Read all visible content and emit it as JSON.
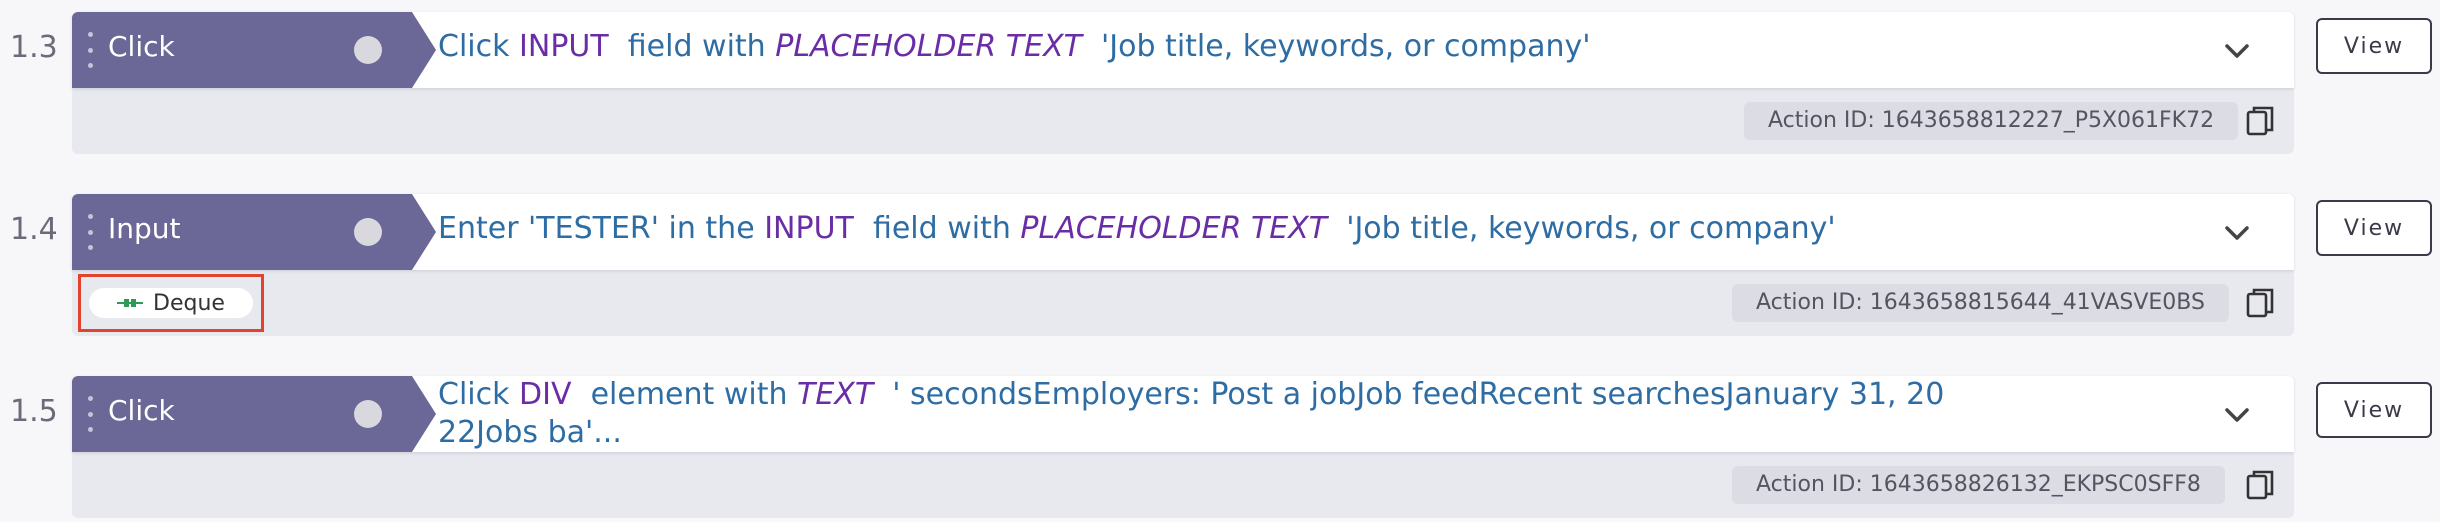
{
  "view_label": "View",
  "steps": [
    {
      "number": "1.3",
      "action_type": "Click",
      "desc": {
        "verb": "Click ",
        "element": "INPUT",
        "mid": "  field with ",
        "keyword": "PLACEHOLDER TEXT",
        "value": "  'Job title, keywords, or company'"
      },
      "action_id": "Action ID: 1643658812227_P5X061FK72"
    },
    {
      "number": "1.4",
      "action_type": "Input",
      "desc": {
        "verb": "Enter 'TESTER' in the ",
        "element": "INPUT",
        "mid": "  field with ",
        "keyword": "PLACEHOLDER TEXT",
        "value": "  'Job title, keywords, or company'"
      },
      "tag": "Deque",
      "action_id": "Action ID: 1643658815644_41VASVE0BS"
    },
    {
      "number": "1.5",
      "action_type": "Click",
      "desc": {
        "verb": "Click ",
        "element": "DIV",
        "mid": "  element with ",
        "keyword": "TEXT",
        "value": "  ' secondsEmployers: Post a jobJob feedRecent searchesJanuary 31, 2022Jobs ba'..."
      },
      "action_id": "Action ID: 1643658826132_EKPSC0SFF8"
    }
  ],
  "colors": {
    "action_type_bg": "#6b6897",
    "desc_text": "#2e6da4",
    "element_text": "#6a2da6",
    "highlight_box": "#e0442e"
  },
  "icons": [
    "drag-handle-icon",
    "toggle-circle-icon",
    "chevron-down-icon",
    "copy-icon",
    "plugin-tag-icon"
  ]
}
